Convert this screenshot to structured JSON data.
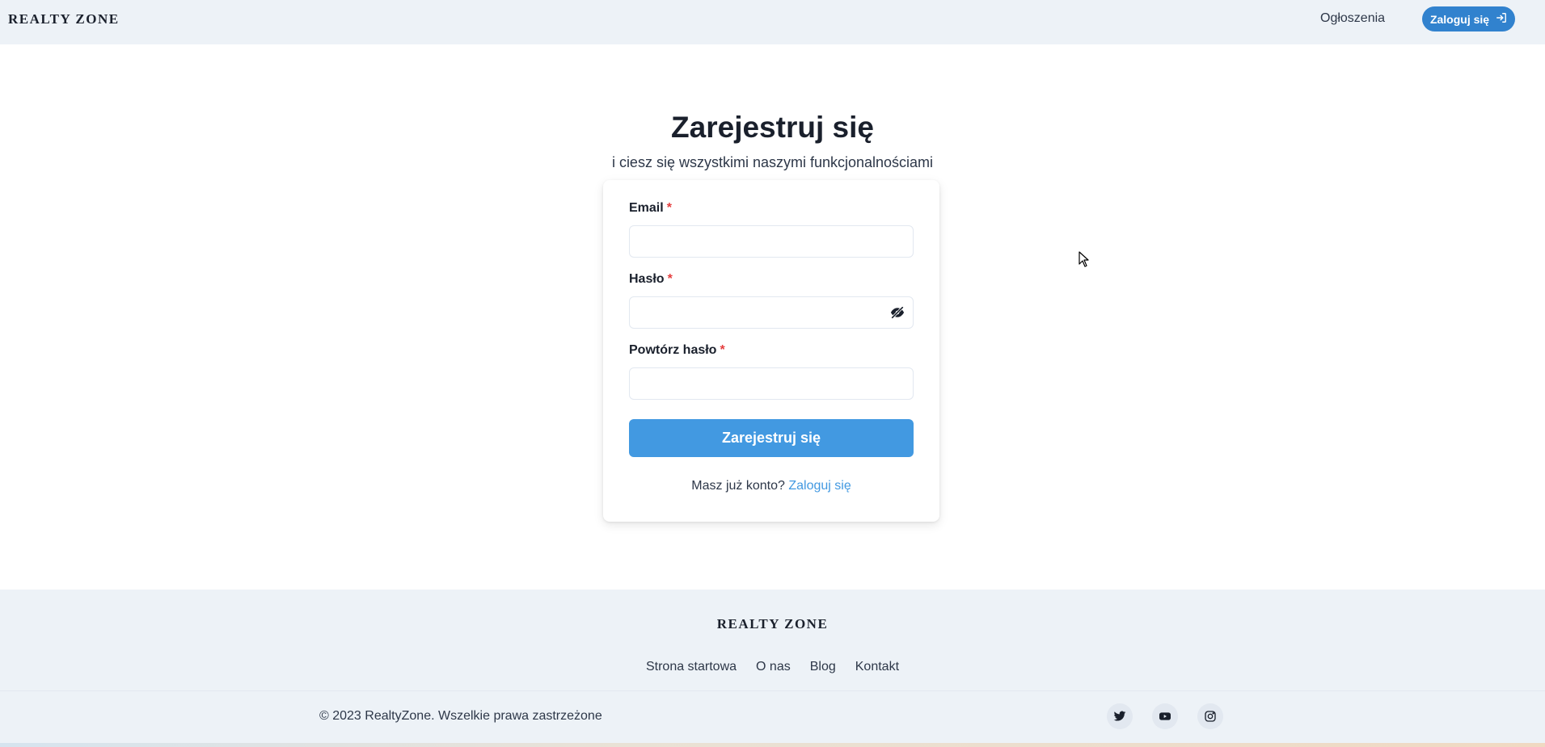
{
  "header": {
    "logo": "REALTY ZONE",
    "nav_listings": "Ogłoszenia",
    "login_button": "Zaloguj się",
    "login_icon": "login-arrow-icon"
  },
  "main": {
    "title": "Zarejestruj się",
    "subtitle": "i ciesz się wszystkimi naszymi funkcjonalnościami",
    "form": {
      "email_label": "Email",
      "email_value": "",
      "password_label": "Hasło",
      "password_value": "",
      "repeat_password_label": "Powtórz hasło",
      "repeat_password_value": "",
      "required_marker": "*",
      "toggle_visibility_icon": "eye-off-icon",
      "submit_label": "Zarejestruj się",
      "have_account_text": "Masz już konto?",
      "login_link": "Zaloguj się"
    }
  },
  "footer": {
    "logo": "REALTY ZONE",
    "links": [
      "Strona startowa",
      "O nas",
      "Blog",
      "Kontakt"
    ],
    "copyright": "© 2023 RealtyZone. Wszelkie prawa zastrzeżone",
    "social_icons": [
      "twitter-icon",
      "youtube-icon",
      "instagram-icon"
    ]
  },
  "colors": {
    "accent": "#3182ce",
    "button": "#4299e1",
    "required": "#e53e3e",
    "header_bg": "#edf2f7"
  }
}
